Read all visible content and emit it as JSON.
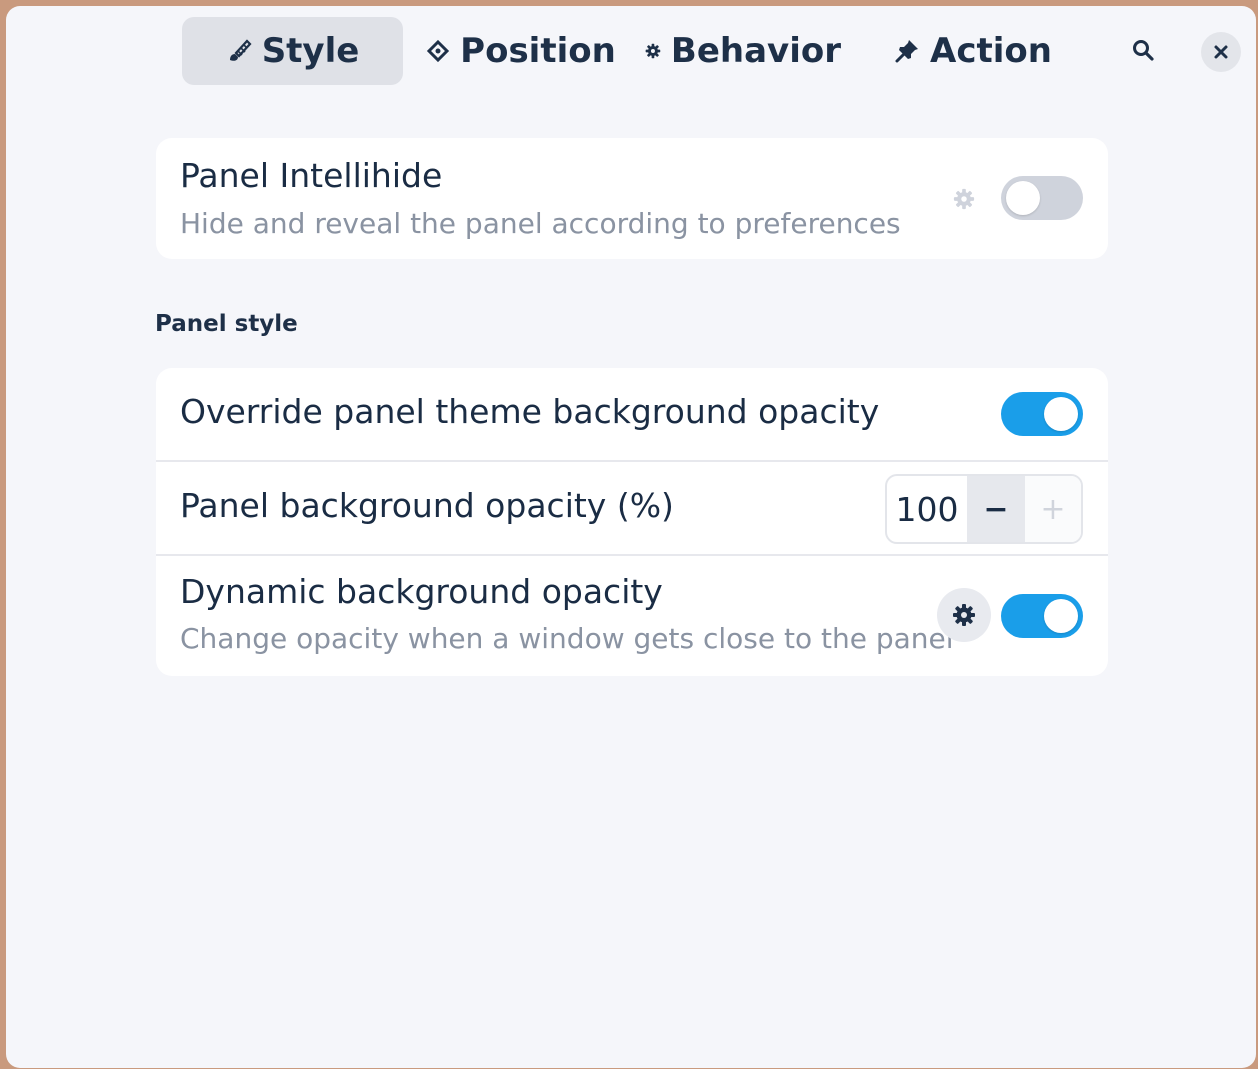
{
  "colors": {
    "accent": "#1a9ee9",
    "text": "#1a2c44",
    "subtitle": "#8a93a2",
    "background": "#f5f6fa",
    "card": "#ffffff"
  },
  "header": {
    "tabs": [
      {
        "label": "Style",
        "icon": "paintbrush-icon",
        "active": true
      },
      {
        "label": "Position",
        "icon": "position-target-icon",
        "active": false
      },
      {
        "label": "Behavior",
        "icon": "gear-icon",
        "active": false
      },
      {
        "label": "Action",
        "icon": "pin-icon",
        "active": false
      }
    ],
    "search_icon": "search-icon",
    "close_icon": "close-icon"
  },
  "intellihide": {
    "title": "Panel Intellihide",
    "subtitle": "Hide and reveal the panel according to preferences",
    "enabled": false,
    "settings_icon": "gear-icon"
  },
  "panel_style": {
    "section_label": "Panel style",
    "override_opacity": {
      "title": "Override panel theme background opacity",
      "enabled": true
    },
    "bg_opacity": {
      "title": "Panel background opacity (%)",
      "value": "100",
      "minus": "−",
      "plus": "+"
    },
    "dynamic_opacity": {
      "title": "Dynamic background opacity",
      "subtitle": "Change opacity when a window gets close to the panel",
      "enabled": true,
      "settings_icon": "gear-icon"
    }
  }
}
